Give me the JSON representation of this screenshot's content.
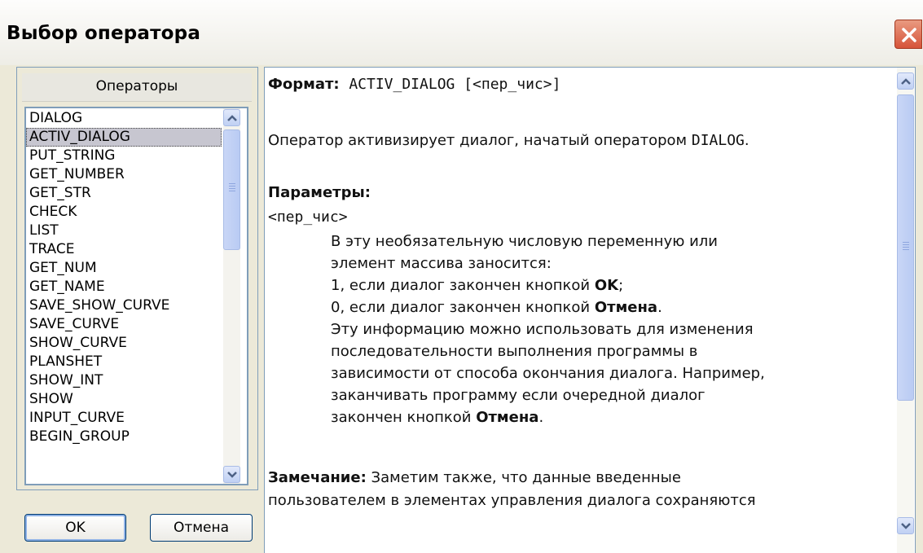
{
  "window": {
    "title": "Выбор оператора"
  },
  "operators": {
    "header": "Операторы",
    "items": [
      "DIALOG",
      "ACTIV_DIALOG",
      "PUT_STRING",
      "GET_NUMBER",
      "GET_STR",
      "CHECK",
      "LIST",
      "TRACE",
      "GET_NUM",
      "GET_NAME",
      "SAVE_SHOW_CURVE",
      "SAVE_CURVE",
      "SHOW_CURVE",
      "PLANSHET",
      "SHOW_INT",
      "SHOW",
      "INPUT_CURVE",
      "BEGIN_GROUP"
    ],
    "selected": "ACTIV_DIALOG"
  },
  "buttons": {
    "ok": "OK",
    "cancel": "Отмена"
  },
  "help": {
    "format_label": "Формат:",
    "format_code": "ACTIV_DIALOG [<пер_чис>]",
    "description_text": "Оператор активизирует диалог, начатый оператором ",
    "description_code": "DIALOG",
    "description_end": ".",
    "params_label": "Параметры:",
    "param_name": "<пер_чис>",
    "param_line1": "В эту необязательную числовую переменную или",
    "param_line2": "элемент массива заносится:",
    "param_line3_text": "1, если диалог закончен кнопкой ",
    "param_line3_bold": "OK",
    "param_line3_end": ";",
    "param_line4_text": "0, если диалог закончен кнопкой ",
    "param_line4_bold": "Отмена",
    "param_line4_end": ".",
    "param_line5": "Эту информацию можно использовать для изменения",
    "param_line6": "последовательности выполнения программы в",
    "param_line7": "зависимости от способа окончания диалога. Например,",
    "param_line8": "заканчивать программу если очередной диалог",
    "param_line9_text": "закончен кнопкой ",
    "param_line9_bold": "Отмена",
    "param_line9_end": ".",
    "note_label": "Замечание:",
    "note_line1": " Заметим также, что данные введенные",
    "note_line2": "пользователем в элементах управления диалога сохраняются"
  },
  "icons": {
    "close": "close-icon",
    "scroll_up": "arrow-up-icon",
    "scroll_down": "arrow-down-icon"
  },
  "colors": {
    "close_button": "#d6543a",
    "selection": "#c7c6d0",
    "border": "#7f9db9"
  }
}
